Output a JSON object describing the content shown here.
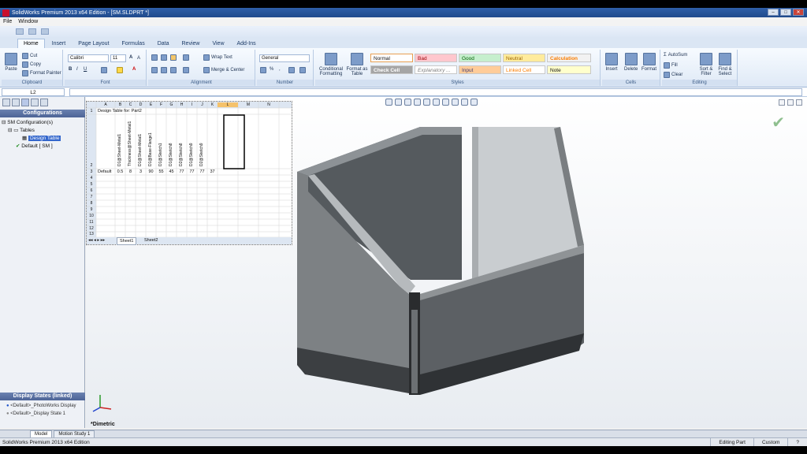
{
  "title": "SolidWorks Premium 2013 x64 Edition - [SM.SLDPRT *]",
  "menu": [
    "File",
    "Window"
  ],
  "tabs": [
    "Home",
    "Insert",
    "Page Layout",
    "Formulas",
    "Data",
    "Review",
    "View",
    "Add-Ins"
  ],
  "clipboard": {
    "paste": "Paste",
    "cut": "Cut",
    "copy": "Copy",
    "format_painter": "Format Painter",
    "label": "Clipboard"
  },
  "font": {
    "name": "Calibri",
    "size": "11",
    "label": "Font"
  },
  "alignment": {
    "wrap": "Wrap Text",
    "merge": "Merge & Center",
    "label": "Alignment"
  },
  "number": {
    "format": "General",
    "label": "Number"
  },
  "styles": {
    "cond": "Conditional Formatting",
    "table": "Format as Table",
    "label": "Styles",
    "cells": [
      "Normal",
      "Bad",
      "Good",
      "Neutral",
      "Calculation",
      "Check Cell",
      "Explanatory ...",
      "Input",
      "Linked Cell",
      "Note"
    ]
  },
  "cells_group": {
    "insert": "Insert",
    "delete": "Delete",
    "format": "Format",
    "label": "Cells"
  },
  "editing": {
    "autosum": "AutoSum",
    "fill": "Fill",
    "clear": "Clear",
    "sort": "Sort & Filter",
    "find": "Find & Select",
    "label": "Editing"
  },
  "namebox": "L2",
  "left_panel": {
    "header": "Configurations",
    "tree": [
      "SM Configuration(s)",
      "Tables",
      "Design Table",
      "Default [ SM ]"
    ],
    "display_header": "Display States (linked)",
    "display_states": [
      "<Default>_PhotoWorks Display",
      "<Default>_Display State 1"
    ]
  },
  "sheet": {
    "cols": [
      "A",
      "B",
      "C",
      "D",
      "E",
      "F",
      "G",
      "H",
      "I",
      "J",
      "K",
      "L",
      "M",
      "N"
    ],
    "title": "Design Table for: Part2",
    "headers": [
      "D1@Sheet-Metal1",
      "Thickness@Sheet-Metal1",
      "D1@Sheet-Metal1",
      "D1@Base-Flange1",
      "D1@Sketch1",
      "D1@Sketch8",
      "D2@Sketch8",
      "D1@Sketch9",
      "D2@Sketch9"
    ],
    "row_label": "Default",
    "values": [
      "0.5",
      "8",
      "3",
      "90",
      "55",
      "45",
      "77",
      "77",
      "77",
      "37"
    ],
    "rows": [
      "1",
      "2",
      "3",
      "4",
      "5",
      "6",
      "7",
      "8",
      "9",
      "10",
      "11",
      "12",
      "13"
    ],
    "sheet_tabs": [
      "Sheet1",
      "Sheet2"
    ]
  },
  "viewname": "*Dimetric",
  "model_tabs": [
    "Model",
    "Motion Study 1"
  ],
  "status": {
    "left": "SolidWorks Premium 2013 x64 Edition",
    "editing": "Editing Part",
    "custom": "Custom"
  }
}
